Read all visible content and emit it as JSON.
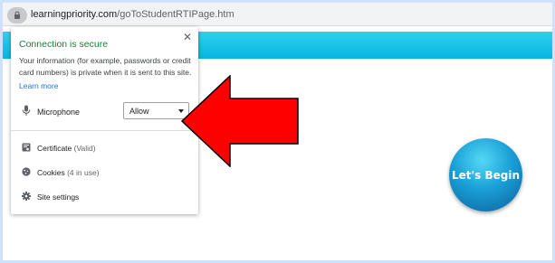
{
  "address_bar": {
    "host": "learningpriority.com",
    "path": "/goToStudentRTIPage.htm",
    "lock_icon": "lock-icon"
  },
  "page": {
    "header_color": "#07b5e0",
    "begin_button_label": "Let's Begin"
  },
  "site_info_popup": {
    "title": "Connection is secure",
    "description": "Your information (for example, passwords or credit card numbers) is private when it is sent to this site.",
    "learn_more": "Learn more",
    "close_icon": "close-icon",
    "permission": {
      "icon": "microphone-icon",
      "label": "Microphone",
      "value": "Allow"
    },
    "items": [
      {
        "icon": "certificate-icon",
        "label": "Certificate",
        "detail": "(Valid)"
      },
      {
        "icon": "cookie-icon",
        "label": "Cookies",
        "detail": "(4 in use)"
      },
      {
        "icon": "gear-icon",
        "label": "Site settings",
        "detail": ""
      }
    ]
  },
  "annotation": {
    "arrow_color": "#ff0000",
    "pointing_at": "microphone permission dropdown"
  }
}
